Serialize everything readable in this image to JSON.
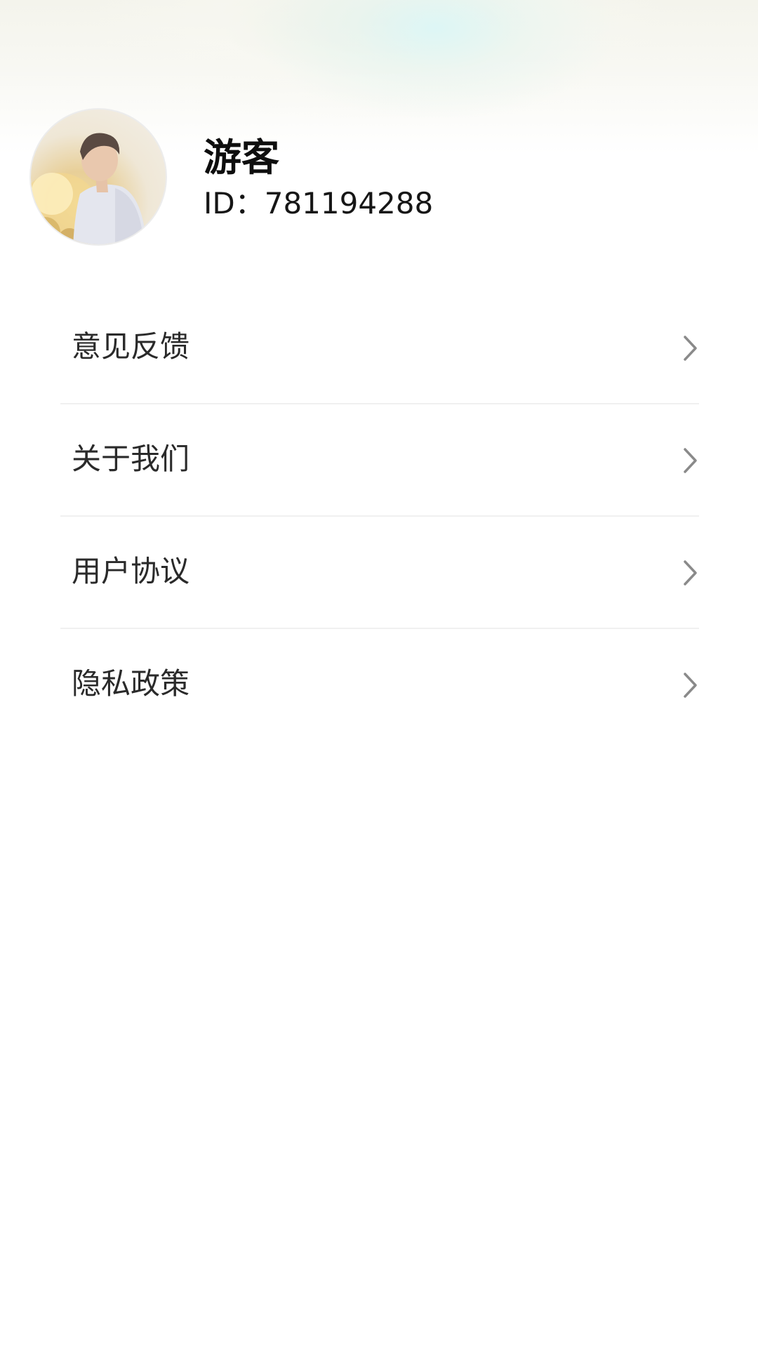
{
  "profile": {
    "name": "游客",
    "id_text": "ID：781194288"
  },
  "menu": {
    "items": [
      {
        "label": "意见反馈",
        "icon": "chevron-right-icon"
      },
      {
        "label": "关于我们",
        "icon": "chevron-right-icon"
      },
      {
        "label": "用户协议",
        "icon": "chevron-right-icon"
      },
      {
        "label": "隐私政策",
        "icon": "chevron-right-icon"
      }
    ]
  },
  "colors": {
    "chevron": "#8a8a8a",
    "label": "#2a2a2a",
    "divider": "#f0f0f0"
  }
}
